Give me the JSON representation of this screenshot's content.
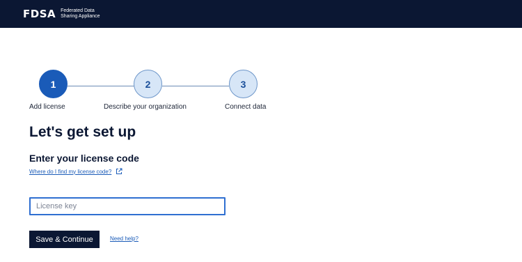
{
  "header": {
    "logo_text": "FDSA",
    "logo_subtitle": "Federated Data Sharing Appliance"
  },
  "stepper": {
    "steps": [
      {
        "number": "1",
        "label": "Add license",
        "state": "active"
      },
      {
        "number": "2",
        "label": "Describe your organization",
        "state": "inactive"
      },
      {
        "number": "3",
        "label": "Connect data",
        "state": "inactive"
      }
    ]
  },
  "main": {
    "title": "Let's get set up",
    "subtitle": "Enter your license code",
    "help_link": "Where do I find my license code?",
    "license_input": {
      "placeholder": "License key",
      "value": ""
    },
    "save_button": "Save & Continue",
    "need_help": "Need help?"
  },
  "colors": {
    "header_bg": "#0b1733",
    "accent": "#1a5bb8",
    "step_inactive_bg": "#d7e6f7"
  },
  "icons": {
    "help_link_icon": "external-link-icon"
  }
}
